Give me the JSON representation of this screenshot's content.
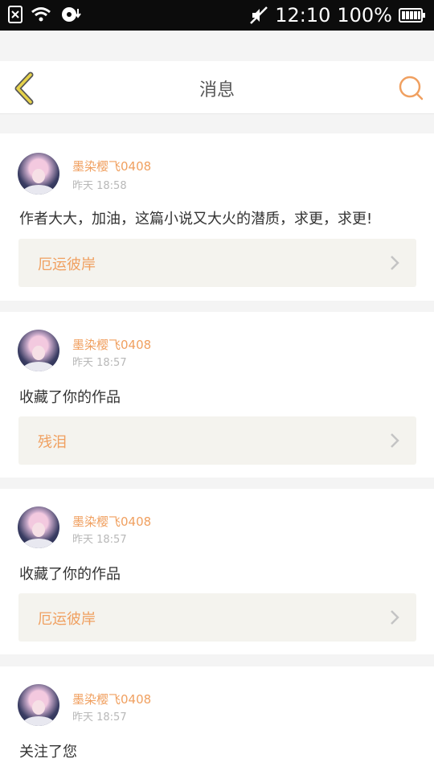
{
  "status_bar": {
    "time": "12:10",
    "battery_pct": "100%",
    "icons": [
      "sim-off-icon",
      "wifi-icon",
      "download-icon",
      "mute-icon",
      "battery-icon"
    ]
  },
  "header": {
    "title": "消息",
    "accent_color": "#f0a060",
    "back_icon_color": "#d8c33a"
  },
  "messages": [
    {
      "username": "墨染樱飞0408",
      "time": "昨天 18:58",
      "text": "作者大大，加油，这篇小说又大火的潜质，求更，求更!",
      "work_title": "厄运彼岸"
    },
    {
      "username": "墨染樱飞0408",
      "time": "昨天 18:57",
      "text": "收藏了你的作品",
      "work_title": "残泪"
    },
    {
      "username": "墨染樱飞0408",
      "time": "昨天 18:57",
      "text": "收藏了你的作品",
      "work_title": "厄运彼岸"
    },
    {
      "username": "墨染樱飞0408",
      "time": "昨天 18:57",
      "text": "关注了您"
    }
  ]
}
